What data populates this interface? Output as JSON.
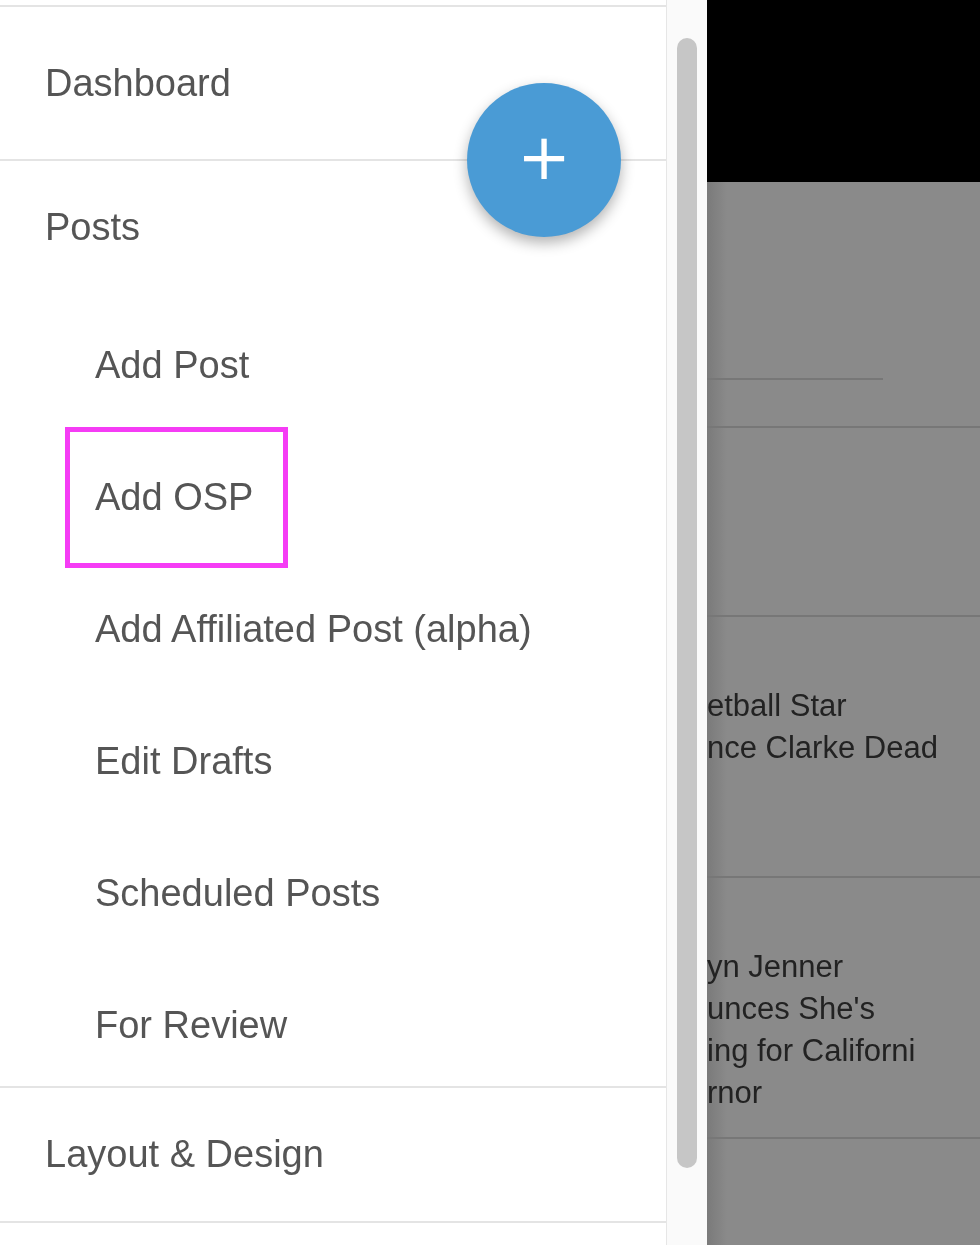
{
  "sidebar": {
    "items": [
      {
        "label": "Dashboard"
      },
      {
        "label": "Posts",
        "children": [
          {
            "label": "Add Post",
            "highlighted": false
          },
          {
            "label": "Add OSP",
            "highlighted": true
          },
          {
            "label": "Add Affiliated Post (alpha)",
            "highlighted": false
          },
          {
            "label": "Edit Drafts",
            "highlighted": false
          },
          {
            "label": "Scheduled Posts",
            "highlighted": false
          },
          {
            "label": "For Review",
            "highlighted": false
          }
        ]
      },
      {
        "label": "Layout & Design"
      }
    ],
    "fab": {
      "label": "+"
    }
  },
  "background_list": {
    "headlines": [
      "etball Star\nnce Clarke Dead",
      "yn Jenner\nunces She's\ning for Californi\nrnor"
    ]
  }
}
